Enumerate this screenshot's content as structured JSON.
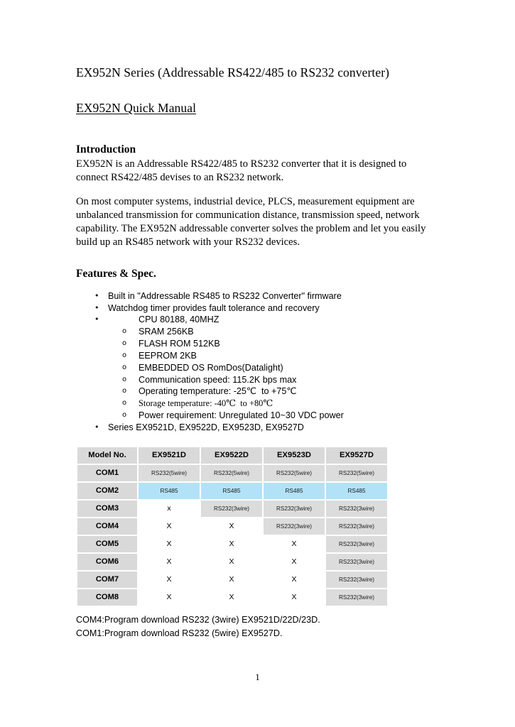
{
  "document": {
    "title": "EX952N Series (Addressable RS422/485 to RS232 converter)",
    "subtitle": "EX952N Quick Manual",
    "page_number": "1"
  },
  "introduction": {
    "heading": "Introduction",
    "paragraph_1": "EX952N is an Addressable RS422/485 to RS232 converter that it is designed to connect RS422/485 devises to an RS232 network.",
    "paragraph_2": "On most computer systems, industrial device, PLCS, measurement equipment are unbalanced transmission for communication distance, transmission speed, network capability.    The EX952N addressable converter solves the problem and let you easily build up an RS485 network with your RS232 devices."
  },
  "features": {
    "heading": "Features & Spec.",
    "items": [
      {
        "level": 1,
        "marker": "•",
        "text": "Built in \"Addressable RS485 to RS232 Converter\" firmware"
      },
      {
        "level": 1,
        "marker": "•",
        "text": "Watchdog timer provides fault tolerance and recovery"
      },
      {
        "level": 1,
        "marker": "•",
        "text": "CPU 80188, 40MHZ",
        "tabbed": true
      },
      {
        "level": 2,
        "marker": "o",
        "text": "SRAM 256KB"
      },
      {
        "level": 2,
        "marker": "o",
        "text": "FLASH ROM 512KB"
      },
      {
        "level": 2,
        "marker": "o",
        "text": "EEPROM 2KB"
      },
      {
        "level": 2,
        "marker": "o",
        "text": "EMBEDDED OS RomDos(Datalight)"
      },
      {
        "level": 2,
        "marker": "o",
        "text": "Communication speed: 115.2K bps max"
      },
      {
        "level": 2,
        "marker": "o",
        "text": "Operating temperature: -25℃  to +75℃"
      },
      {
        "level": 2,
        "marker": "o",
        "text": "Storage temperature: -40℃  to +80℃",
        "serif": true
      },
      {
        "level": 2,
        "marker": "o",
        "text": "Power requirement: Unregulated 10~30 VDC power"
      },
      {
        "level": 1,
        "marker": "•",
        "text": "Series EX9521D, EX9522D, EX9523D, EX9527D"
      }
    ]
  },
  "spec_table": {
    "columns": [
      "Model No.",
      "EX9521D",
      "EX9522D",
      "EX9523D",
      "EX9527D"
    ],
    "rows": [
      {
        "label": "COM1",
        "cells": [
          {
            "text": "RS232(5wire)",
            "style": "gray"
          },
          {
            "text": "RS232(5wire)",
            "style": "gray"
          },
          {
            "text": "RS232(5wire)",
            "style": "gray"
          },
          {
            "text": "RS232(5wire)",
            "style": "gray"
          }
        ]
      },
      {
        "label": "COM2",
        "cells": [
          {
            "text": "RS485",
            "style": "blue"
          },
          {
            "text": "RS485",
            "style": "blue"
          },
          {
            "text": "RS485",
            "style": "blue"
          },
          {
            "text": "RS485",
            "style": "blue"
          }
        ]
      },
      {
        "label": "COM3",
        "cells": [
          {
            "text": "x",
            "style": "plain"
          },
          {
            "text": "RS232(3wire)",
            "style": "gray"
          },
          {
            "text": "RS232(3wire)",
            "style": "gray"
          },
          {
            "text": "RS232(3wire)",
            "style": "gray"
          }
        ]
      },
      {
        "label": "COM4",
        "cells": [
          {
            "text": "X",
            "style": "plain"
          },
          {
            "text": "X",
            "style": "plain"
          },
          {
            "text": "RS232(3wire)",
            "style": "gray"
          },
          {
            "text": "RS232(3wire)",
            "style": "gray"
          }
        ]
      },
      {
        "label": "COM5",
        "cells": [
          {
            "text": "X",
            "style": "plain"
          },
          {
            "text": "X",
            "style": "plain"
          },
          {
            "text": "X",
            "style": "plain"
          },
          {
            "text": "RS232(3wire)",
            "style": "gray"
          }
        ]
      },
      {
        "label": "COM6",
        "cells": [
          {
            "text": "X",
            "style": "plain"
          },
          {
            "text": "X",
            "style": "plain"
          },
          {
            "text": "X",
            "style": "plain"
          },
          {
            "text": "RS232(3wire)",
            "style": "gray"
          }
        ]
      },
      {
        "label": "COM7",
        "cells": [
          {
            "text": "X",
            "style": "plain"
          },
          {
            "text": "X",
            "style": "plain"
          },
          {
            "text": "X",
            "style": "plain"
          },
          {
            "text": "RS232(3wire)",
            "style": "gray"
          }
        ]
      },
      {
        "label": "COM8",
        "cells": [
          {
            "text": "X",
            "style": "plain"
          },
          {
            "text": "X",
            "style": "plain"
          },
          {
            "text": "X",
            "style": "plain"
          },
          {
            "text": "RS232(3wire)",
            "style": "gray"
          }
        ]
      }
    ],
    "colors": {
      "header_gray": "#d9d9d9",
      "cell_gray": "#dcdcdc",
      "highlight_blue": "#b2e2f7"
    }
  },
  "notes": [
    "COM4:Program download RS232 (3wire) EX9521D/22D/23D.",
    "COM1:Program download RS232 (5wire) EX9527D."
  ]
}
